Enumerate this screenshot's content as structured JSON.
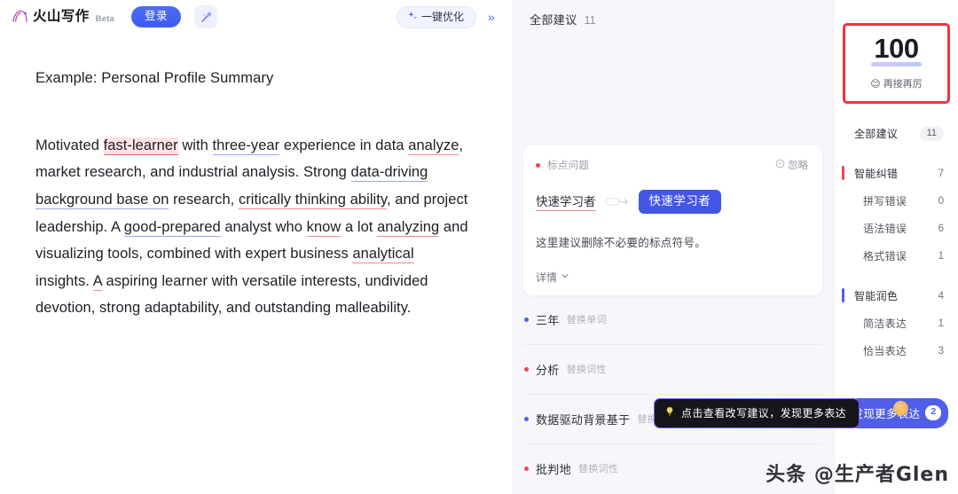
{
  "topbar": {
    "logo_text": "火山写作",
    "beta_tag": "Beta",
    "login_label": "登录",
    "wand_icon": "magic-wand-icon",
    "optimize_label": "一键优化",
    "optimize_icon": "sparkle-icon",
    "collapse_label": "»"
  },
  "document": {
    "title": "Example: Personal Profile Summary",
    "paragraph": {
      "t1": "Motivated ",
      "h1": "fast-learner",
      "t2": " with ",
      "u1": "three-year",
      "t3": " experience in data ",
      "u2": "analyze",
      "t4": ", market research, and industrial analysis. Strong ",
      "u3": "data-driving background base on",
      "t5": " research, ",
      "u4": "critically thinking ability",
      "t6": ", and project leadership. A ",
      "u5": "good-prepared",
      "t7": " analyst who ",
      "u6": "know",
      "t8": " a lot ",
      "u7": "analyzing",
      "t9": " and visualizing tools, combined with expert business ",
      "u8": "analytical",
      "t10": " insights. ",
      "u9": "A",
      "t11": " aspiring learner with versatile interests, undivided devotion, strong adaptability, and outstanding malleability."
    }
  },
  "suggestions_panel": {
    "header_title": "全部建议",
    "header_count": "11",
    "card": {
      "dot": "red-dot",
      "tag": "标点问题",
      "ignore_icon": "minus-circle-icon",
      "ignore_label": "忽略",
      "original": "快速学习者",
      "arrow_icon": "arrow-right-icon",
      "replacement": "快速学习者",
      "description": "这里建议删除不必要的标点符号。",
      "detail_label": "详情",
      "detail_icon": "chevron-down-icon"
    },
    "items": [
      {
        "dot": "blue-dot",
        "word": "三年",
        "kind": "替换单词"
      },
      {
        "dot": "red-dot",
        "word": "分析",
        "kind": "替换词性"
      },
      {
        "dot": "blue-dot",
        "word": "数据驱动背景基于",
        "kind": "替换短语"
      },
      {
        "dot": "red-dot",
        "word": "批判地",
        "kind": "替换词性"
      }
    ],
    "tooltip": {
      "icon": "lightbulb-icon",
      "text": "点击查看改写建议，发现更多表达"
    }
  },
  "sidebar": {
    "score": {
      "value": "100",
      "emoji": "😊",
      "caption": "再接再厉"
    },
    "categories": [
      {
        "label": "全部建议",
        "count": "11",
        "style": "pill",
        "bar": ""
      },
      {
        "label": "智能纠错",
        "count": "7",
        "style": "head",
        "bar": "#ef4457"
      },
      {
        "label": "拼写错误",
        "count": "0",
        "style": "indent",
        "bar": ""
      },
      {
        "label": "语法错误",
        "count": "6",
        "style": "indent",
        "bar": ""
      },
      {
        "label": "格式错误",
        "count": "1",
        "style": "indent",
        "bar": ""
      },
      {
        "label": "智能润色",
        "count": "4",
        "style": "head",
        "bar": "#4f5fe8"
      },
      {
        "label": "简洁表达",
        "count": "1",
        "style": "indent",
        "bar": ""
      },
      {
        "label": "恰当表达",
        "count": "3",
        "style": "indent",
        "bar": ""
      }
    ],
    "discover": {
      "label": "发现更多表达",
      "badge": "2"
    }
  },
  "watermark": "头条 @生产者Glen"
}
